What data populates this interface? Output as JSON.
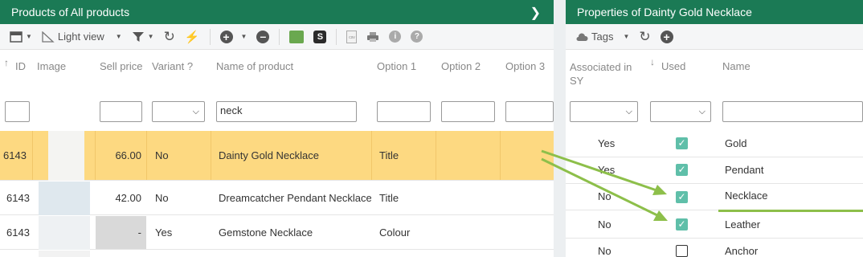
{
  "left_panel": {
    "title": "Products of All products",
    "toolbar": {
      "view_label": "Light view"
    },
    "columns": {
      "id": "ID",
      "image": "Image",
      "sell_price": "Sell price",
      "variant": "Variant ?",
      "name": "Name of product",
      "option1": "Option 1",
      "option2": "Option 2",
      "option3": "Option 3"
    },
    "filters": {
      "name_value": "neck"
    },
    "rows": [
      {
        "id": "6143",
        "sell_price": "66.00",
        "variant": "No",
        "name": "Dainty Gold Necklace",
        "option1": "Title",
        "selected": true
      },
      {
        "id": "6143",
        "sell_price": "42.00",
        "variant": "No",
        "name": "Dreamcatcher Pendant Necklace",
        "option1": "Title"
      },
      {
        "id": "6143",
        "sell_price": "-",
        "variant": "Yes",
        "name": "Gemstone Necklace",
        "option1": "Colour"
      }
    ]
  },
  "right_panel": {
    "title": "Properties of Dainty Gold Necklace",
    "toolbar": {
      "tags_label": "Tags"
    },
    "columns": {
      "associated": "Associated in SY",
      "used": "Used",
      "name": "Name"
    },
    "rows": [
      {
        "associated": "Yes",
        "used": true,
        "name": "Gold"
      },
      {
        "associated": "Yes",
        "used": true,
        "name": "Pendant"
      },
      {
        "associated": "No",
        "used": true,
        "name": "Necklace"
      },
      {
        "associated": "No",
        "used": true,
        "name": "Leather"
      },
      {
        "associated": "No",
        "used": false,
        "name": "Anchor"
      }
    ]
  },
  "colors": {
    "header_green": "#1b7a55",
    "selected_row": "#fdd981",
    "checkbox_teal": "#5fbfa9",
    "arrow_green": "#8dbf4a"
  }
}
